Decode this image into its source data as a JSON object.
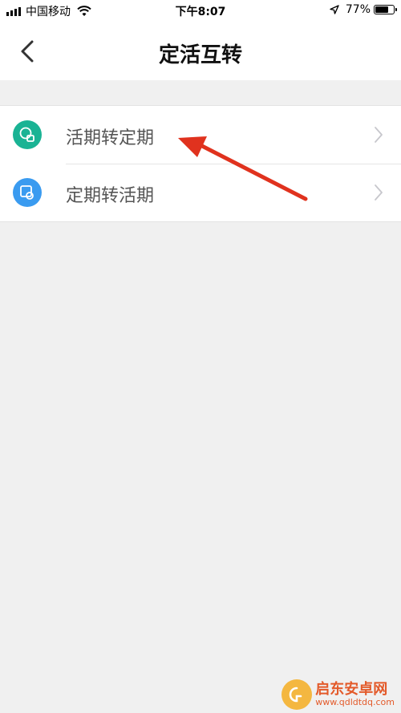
{
  "status_bar": {
    "carrier": "中国移动",
    "time": "下午8:07",
    "battery_percent": "77%",
    "battery_level": 0.77,
    "icons": [
      "signal-icon",
      "wifi-icon",
      "location-icon",
      "battery-icon"
    ]
  },
  "nav": {
    "title": "定活互转",
    "back_icon": "chevron-left-icon"
  },
  "list": {
    "items": [
      {
        "label": "活期转定期",
        "icon": "demand-to-fixed-icon",
        "icon_color": "#1ab394"
      },
      {
        "label": "定期转活期",
        "icon": "fixed-to-demand-icon",
        "icon_color": "#3a9bf0"
      }
    ]
  },
  "annotation": {
    "arrow_color": "#e0321e"
  },
  "watermark": {
    "main": "启东安卓网",
    "sub": "www.qdldtdq.com"
  }
}
